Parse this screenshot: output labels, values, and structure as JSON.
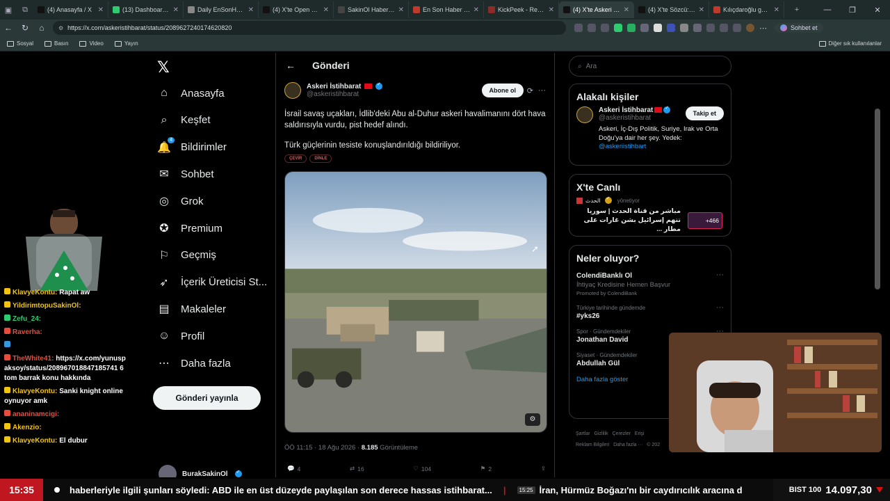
{
  "browser": {
    "tabs": [
      {
        "label": "(4) Anasayfa / X",
        "color": "#111111"
      },
      {
        "label": "(13) Dashboard / St",
        "color": "#2ecc71"
      },
      {
        "label": "Daily EnSonHaber",
        "color": "#888888"
      },
      {
        "label": "(4) X'te Open Source",
        "color": "#111111"
      },
      {
        "label": "SakinOl Haber Merk",
        "color": "#444444"
      },
      {
        "label": "En Son Haber - Hab",
        "color": "#c0392b"
      },
      {
        "label": "KickPeek - Real-tim",
        "color": "#8e2a2a"
      },
      {
        "label": "(4) X'te Askeri İstih",
        "color": "#111111",
        "active": true
      },
      {
        "label": "(4) X'te Sözcü: \"CH",
        "color": "#111111"
      },
      {
        "label": "Kılıçdaroğlu geri ad",
        "color": "#c0392b"
      }
    ],
    "url": "https://x.com/askeristihbarat/status/2089627240174620820",
    "profile_label": "Sohbet et",
    "bookmarks": [
      "Sosyal",
      "Basın",
      "Video",
      "Yayın"
    ],
    "other_bookmarks": "Diğer sık kullanılanlar"
  },
  "nav": {
    "items": [
      {
        "label": "Anasayfa",
        "icon": "home-icon"
      },
      {
        "label": "Keşfet",
        "icon": "search-icon"
      },
      {
        "label": "Bildirimler",
        "icon": "bell-icon",
        "badge": "4"
      },
      {
        "label": "Sohbet",
        "icon": "chat-icon"
      },
      {
        "label": "Grok",
        "icon": "grok-icon"
      },
      {
        "label": "Premium",
        "icon": "premium-icon"
      },
      {
        "label": "Geçmiş",
        "icon": "bookmark-icon"
      },
      {
        "label": "İçerik Üreticisi St...",
        "icon": "rocket-icon"
      },
      {
        "label": "Makaleler",
        "icon": "article-icon"
      },
      {
        "label": "Profil",
        "icon": "profile-icon"
      },
      {
        "label": "Daha fazla",
        "icon": "more-icon"
      }
    ],
    "post_button": "Gönderi yayınla",
    "account_name": "BurakSakinOl"
  },
  "chat": [
    {
      "name": "KlavyeKontu:",
      "text": "Rapat aw",
      "color": "#f1c40f"
    },
    {
      "name": "YildirimtopuSakinOl:",
      "text": "",
      "color": "#f1c40f"
    },
    {
      "name": "Zefu_24:",
      "text": "",
      "color": "#2ecc71"
    },
    {
      "name": "Raverha:",
      "text": "",
      "color": "#e74c3c"
    },
    {
      "name": "",
      "text": "",
      "color": "#3498db"
    },
    {
      "name": "TheWhite41:",
      "text": "https://x.com/yunusp aksoy/status/208967018847185741 6 tom barrak konu hakkında",
      "color": "#e74c3c"
    },
    {
      "name": "KlavyeKontu:",
      "text": "Sanki knight online oynuyor amk",
      "color": "#f1c40f"
    },
    {
      "name": "ananinamcigi:",
      "text": "",
      "color": "#e74c3c"
    },
    {
      "name": "Akenzio:",
      "text": "",
      "color": "#f1c40f"
    },
    {
      "name": "KlavyeKontu:",
      "text": "El dubur",
      "color": "#f1c40f"
    }
  ],
  "main": {
    "header": "Gönderi",
    "tweet": {
      "name": "Askeri İstihbarat",
      "handle": "@askeristihbarat",
      "follow": "Abone ol",
      "para1": "İsrail savaş uçakları, İdlib'deki Abu al-Duhur askeri havalimanını dört hava saldırısıyla vurdu, pist hedef alındı.",
      "para2": "Türk güçlerinin tesiste konuşlandırıldığı bildiriliyor.",
      "pill1": "ÇEVİR",
      "pill2": "DİNLE",
      "time": "ÖÖ 11:15 · 18 Ağu 2026 ·",
      "views": "8.185",
      "views_label": "Görüntüleme",
      "replies": "4",
      "reposts": "16",
      "likes": "104",
      "bookmarks": "2"
    }
  },
  "right": {
    "search_placeholder": "Ara",
    "related_title": "Alakalı kişiler",
    "related": {
      "name": "Askeri İstihbarat",
      "handle": "@askeristihbarat",
      "follow": "Takip et",
      "bio": "Askeri, İç-Dış Politik, Suriye, Irak ve Orta Doğu'ya dair her şey. Yedek:",
      "bio_link": "@askeriistihbart"
    },
    "live_title": "X'te Canlı",
    "live": {
      "host": "الحدث",
      "host_status": "yönetiyor",
      "text": "مباشر من قناة الحدث | سوريا تتهم إسرائيل بشن غارات على مطار ...",
      "count": "+466"
    },
    "trends_title": "Neler oluyor?",
    "trends": [
      {
        "label": "",
        "name": "ColendiBanklı Ol",
        "sub": "İhtiyaç Kredisine Hemen Başvur",
        "promo": "Promoted by ColendiBank"
      },
      {
        "label": "Türkiye tarihinde gündemde",
        "name": "#yks26"
      },
      {
        "label": "Spor · Gündemdekiler",
        "name": "Jonathan David"
      },
      {
        "label": "Siyaset · Gündemdekiler",
        "name": "Abdullah Gül"
      }
    ],
    "show_more": "Daha fazla göster",
    "footer": "Şartlar   Gizlilik   Çerezler   Erişi\nReklam Bilgileri   Daha fazla ···   © 202"
  },
  "ticker": {
    "clock": "15:35",
    "text1": "haberleriyle ilgili şunları söyledi: ABD ile en üst düzeyde paylaşılan son derece hassas istihbarat...",
    "sep": "|",
    "time2": "15:25",
    "text2": "İran, Hürmüz Boğazı'nı bir caydırıcılık aracına d",
    "bist_label": "BIST 100",
    "bist_value": "14.097,30"
  },
  "colors": {
    "accent": "#1d9bf0",
    "ticker_red": "#c0161f"
  }
}
